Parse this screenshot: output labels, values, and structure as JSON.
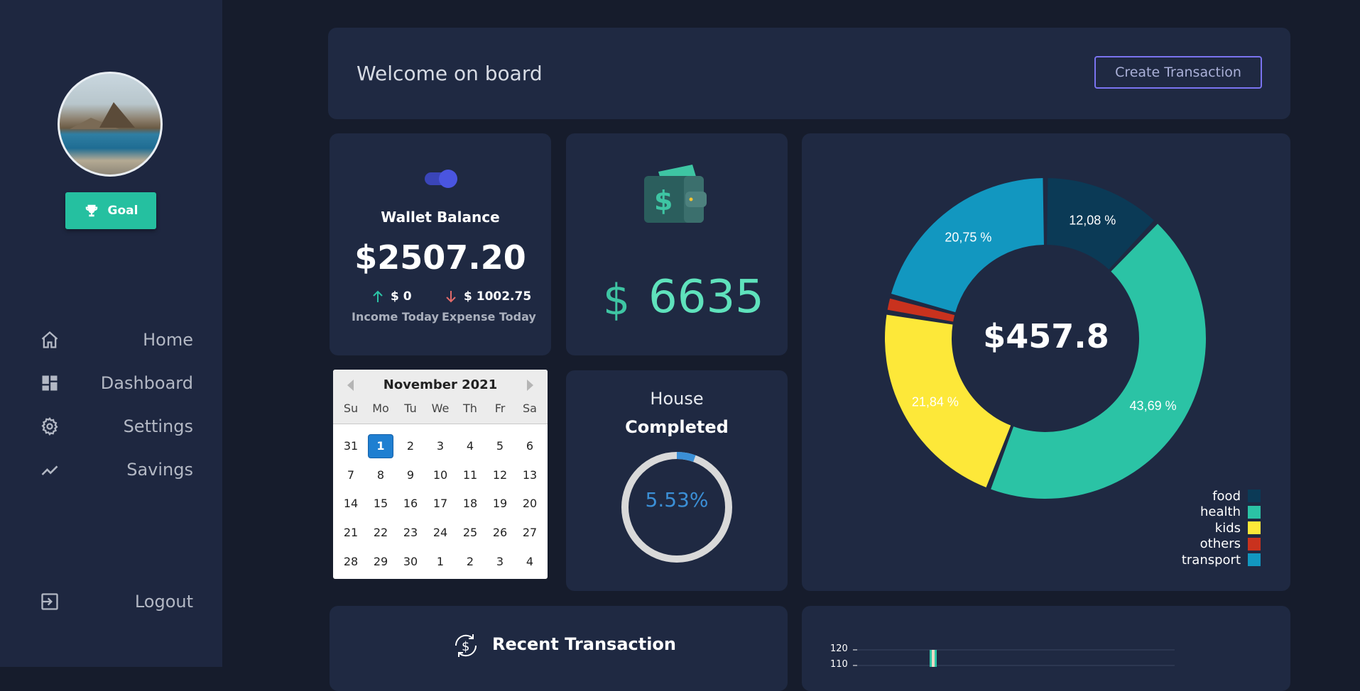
{
  "sidebar": {
    "goal_label": "Goal",
    "nav": [
      {
        "label": "Home",
        "icon": "home-icon"
      },
      {
        "label": "Dashboard",
        "icon": "dashboard-icon"
      },
      {
        "label": "Settings",
        "icon": "gear-icon"
      },
      {
        "label": "Savings",
        "icon": "trending-up-icon"
      }
    ],
    "logout_label": "Logout"
  },
  "header": {
    "welcome": "Welcome on board",
    "create_button": "Create Transaction"
  },
  "wallet": {
    "title": "Wallet Balance",
    "amount": "$2507.20",
    "income_value": "$ 0",
    "income_label": "Income Today",
    "expense_value": "$ 1002.75",
    "expense_label": "Expense Today"
  },
  "cash": {
    "currency": "$",
    "value": "6635"
  },
  "calendar": {
    "title": "November 2021",
    "days_of_week": [
      "Su",
      "Mo",
      "Tu",
      "We",
      "Th",
      "Fr",
      "Sa"
    ],
    "weeks": [
      [
        "31",
        "1",
        "2",
        "3",
        "4",
        "5",
        "6"
      ],
      [
        "7",
        "8",
        "9",
        "10",
        "11",
        "12",
        "13"
      ],
      [
        "14",
        "15",
        "16",
        "17",
        "18",
        "19",
        "20"
      ],
      [
        "21",
        "22",
        "23",
        "24",
        "25",
        "26",
        "27"
      ],
      [
        "28",
        "29",
        "30",
        "1",
        "2",
        "3",
        "4"
      ]
    ],
    "selected": "1"
  },
  "house": {
    "title": "House",
    "status": "Completed",
    "percent_label": "5.53%",
    "progress": 5.53
  },
  "recent": {
    "title": "Recent Transaction"
  },
  "chart_data": [
    {
      "type": "pie",
      "center_label": "$457.8",
      "categories": [
        "food",
        "health",
        "kids",
        "others",
        "transport"
      ],
      "values": [
        12.08,
        43.69,
        21.84,
        1.64,
        20.75
      ],
      "slice_labels": [
        "12,08 %",
        "43,69 %",
        "21,84 %",
        "",
        "20,75 %"
      ],
      "colors": [
        "#0b3a56",
        "#2bc3a5",
        "#fde839",
        "#c9321e",
        "#1297c0"
      ],
      "legend_position": "bottom-right"
    },
    {
      "type": "bar",
      "ytick_labels": [
        "120",
        "110"
      ]
    }
  ]
}
